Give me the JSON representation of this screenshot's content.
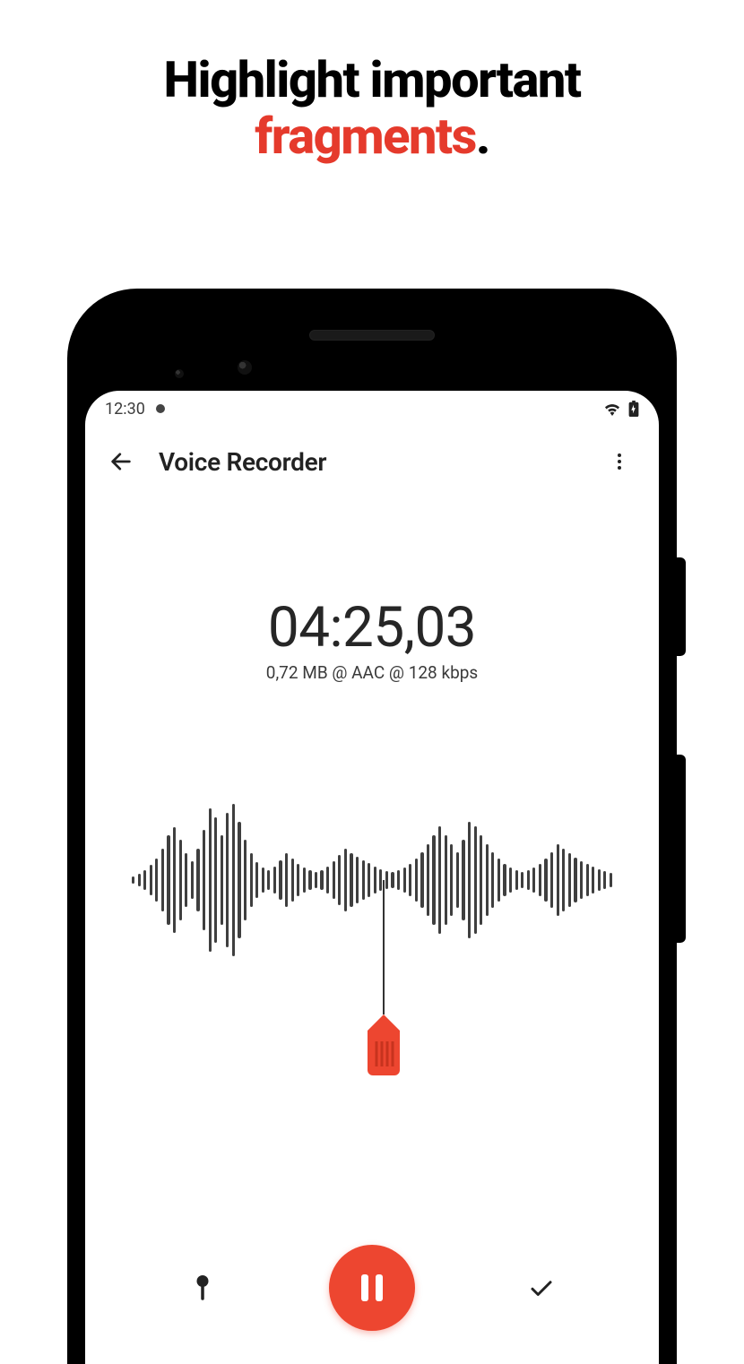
{
  "headline": {
    "line1": "Highlight important",
    "line2_accent": "fragments",
    "dot": "."
  },
  "status": {
    "time": "12:30"
  },
  "appbar": {
    "title": "Voice Recorder"
  },
  "recording": {
    "timer": "04:25,03",
    "meta": "0,72 MB @ AAC @ 128 kbps"
  },
  "waveform": {
    "heights": [
      8,
      14,
      22,
      34,
      48,
      70,
      100,
      118,
      90,
      60,
      42,
      70,
      112,
      160,
      140,
      100,
      150,
      170,
      130,
      90,
      60,
      40,
      28,
      22,
      30,
      44,
      60,
      48,
      36,
      28,
      22,
      18,
      22,
      30,
      42,
      56,
      70,
      60,
      52,
      44,
      38,
      30,
      24,
      20,
      18,
      22,
      28,
      36,
      48,
      62,
      80,
      100,
      120,
      100,
      80,
      62,
      90,
      130,
      120,
      100,
      80,
      62,
      48,
      36,
      28,
      22,
      18,
      22,
      28,
      36,
      48,
      62,
      80,
      70,
      60,
      50,
      42,
      36,
      30,
      24,
      20,
      16
    ]
  },
  "colors": {
    "accent": "#ed4630"
  }
}
